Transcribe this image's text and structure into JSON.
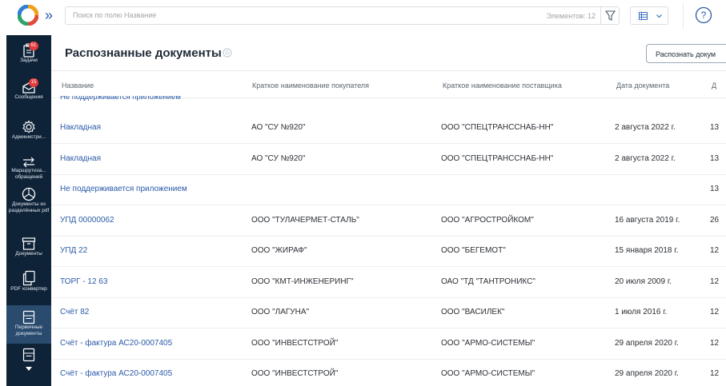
{
  "topbar": {
    "search_placeholder": "Поиск по полю Название",
    "items_count": "Элементов: 12"
  },
  "sidebar": {
    "items": [
      {
        "label": "Задачи",
        "badge": "61",
        "icon": "clipboard-icon"
      },
      {
        "label": "Сообщения",
        "badge": "15",
        "icon": "envelope-icon"
      },
      {
        "label": "Администри...",
        "icon": "gear-icon"
      },
      {
        "label": "Маршрутиза... обращений",
        "icon": "arrows-icon"
      },
      {
        "label": "Документы из разделённых pdf",
        "icon": "chart-icon"
      },
      {
        "label": "Документы",
        "icon": "archive-icon"
      },
      {
        "label": "PDF конвертер",
        "icon": "copy-icon"
      },
      {
        "label": "Первичные документы",
        "icon": "doc-icon",
        "active": true
      },
      {
        "label": "",
        "icon": "doc-icon"
      }
    ]
  },
  "main": {
    "title": "Распознанные документы",
    "recognize_button": "Распознать докум",
    "columns": [
      "Название",
      "Краткое наименование покупателя",
      "Краткое наименование поставщика",
      "Дата документа",
      "Д"
    ],
    "cut_row": "Не поддерживается приложением",
    "rows": [
      {
        "name": "Накладная",
        "buyer": "АО \"СУ №920\"",
        "supplier": "ООО \"СПЕЦТРАНССНАБ-НН\"",
        "date": "2 августа 2022 г.",
        "extra": "13"
      },
      {
        "name": "Накладная",
        "buyer": "АО \"СУ №920\"",
        "supplier": "ООО \"СПЕЦТРАНССНАБ-НН\"",
        "date": "2 августа 2022 г.",
        "extra": "13"
      },
      {
        "name": "Не поддерживается приложением",
        "buyer": "",
        "supplier": "",
        "date": "",
        "extra": "13"
      },
      {
        "name": "УПД 00000062",
        "buyer": "ООО \"ТУЛАЧЕРМЕТ-СТАЛЬ\"",
        "supplier": "ООО \"АГРОСТРОЙКОМ\"",
        "date": "16 августа 2019 г.",
        "extra": "26"
      },
      {
        "name": "УПД 22",
        "buyer": "ООО \"ЖИРАФ\"",
        "supplier": "ООО \"БЕГЕМОТ\"",
        "date": "15 января 2018 г.",
        "extra": "12"
      },
      {
        "name": "ТОРГ - 12 63",
        "buyer": "ООО \"КМТ-ИНЖЕНЕРИНГ\"",
        "supplier": "ОАО \"ТД \"ТАНТРОНИКС\"",
        "date": "20 июля 2009 г.",
        "extra": "12"
      },
      {
        "name": "Счёт 82",
        "buyer": "ООО \"ЛАГУНА\"",
        "supplier": "ООО \"ВАСИЛЕК\"",
        "date": "1 июля 2016 г.",
        "extra": "12"
      },
      {
        "name": "Счёт - фактура АС20-0007405",
        "buyer": "ООО \"ИНВЕСТСТРОЙ\"",
        "supplier": "ООО \"АРМО-СИСТЕМЫ\"",
        "date": "29 апреля 2020 г.",
        "extra": "12"
      },
      {
        "name": "Счёт - фактура АС20-0007405",
        "buyer": "ООО \"ИНВЕСТСТРОЙ\"",
        "supplier": "ООО \"АРМО-СИСТЕМЫ\"",
        "date": "29 апреля 2020 г.",
        "extra": "12"
      }
    ]
  },
  "colors": {
    "sidebar_bg": "#0f2338",
    "sidebar_active": "#2a4b6e",
    "link": "#2a5aa8",
    "badge": "#e23b3b"
  }
}
